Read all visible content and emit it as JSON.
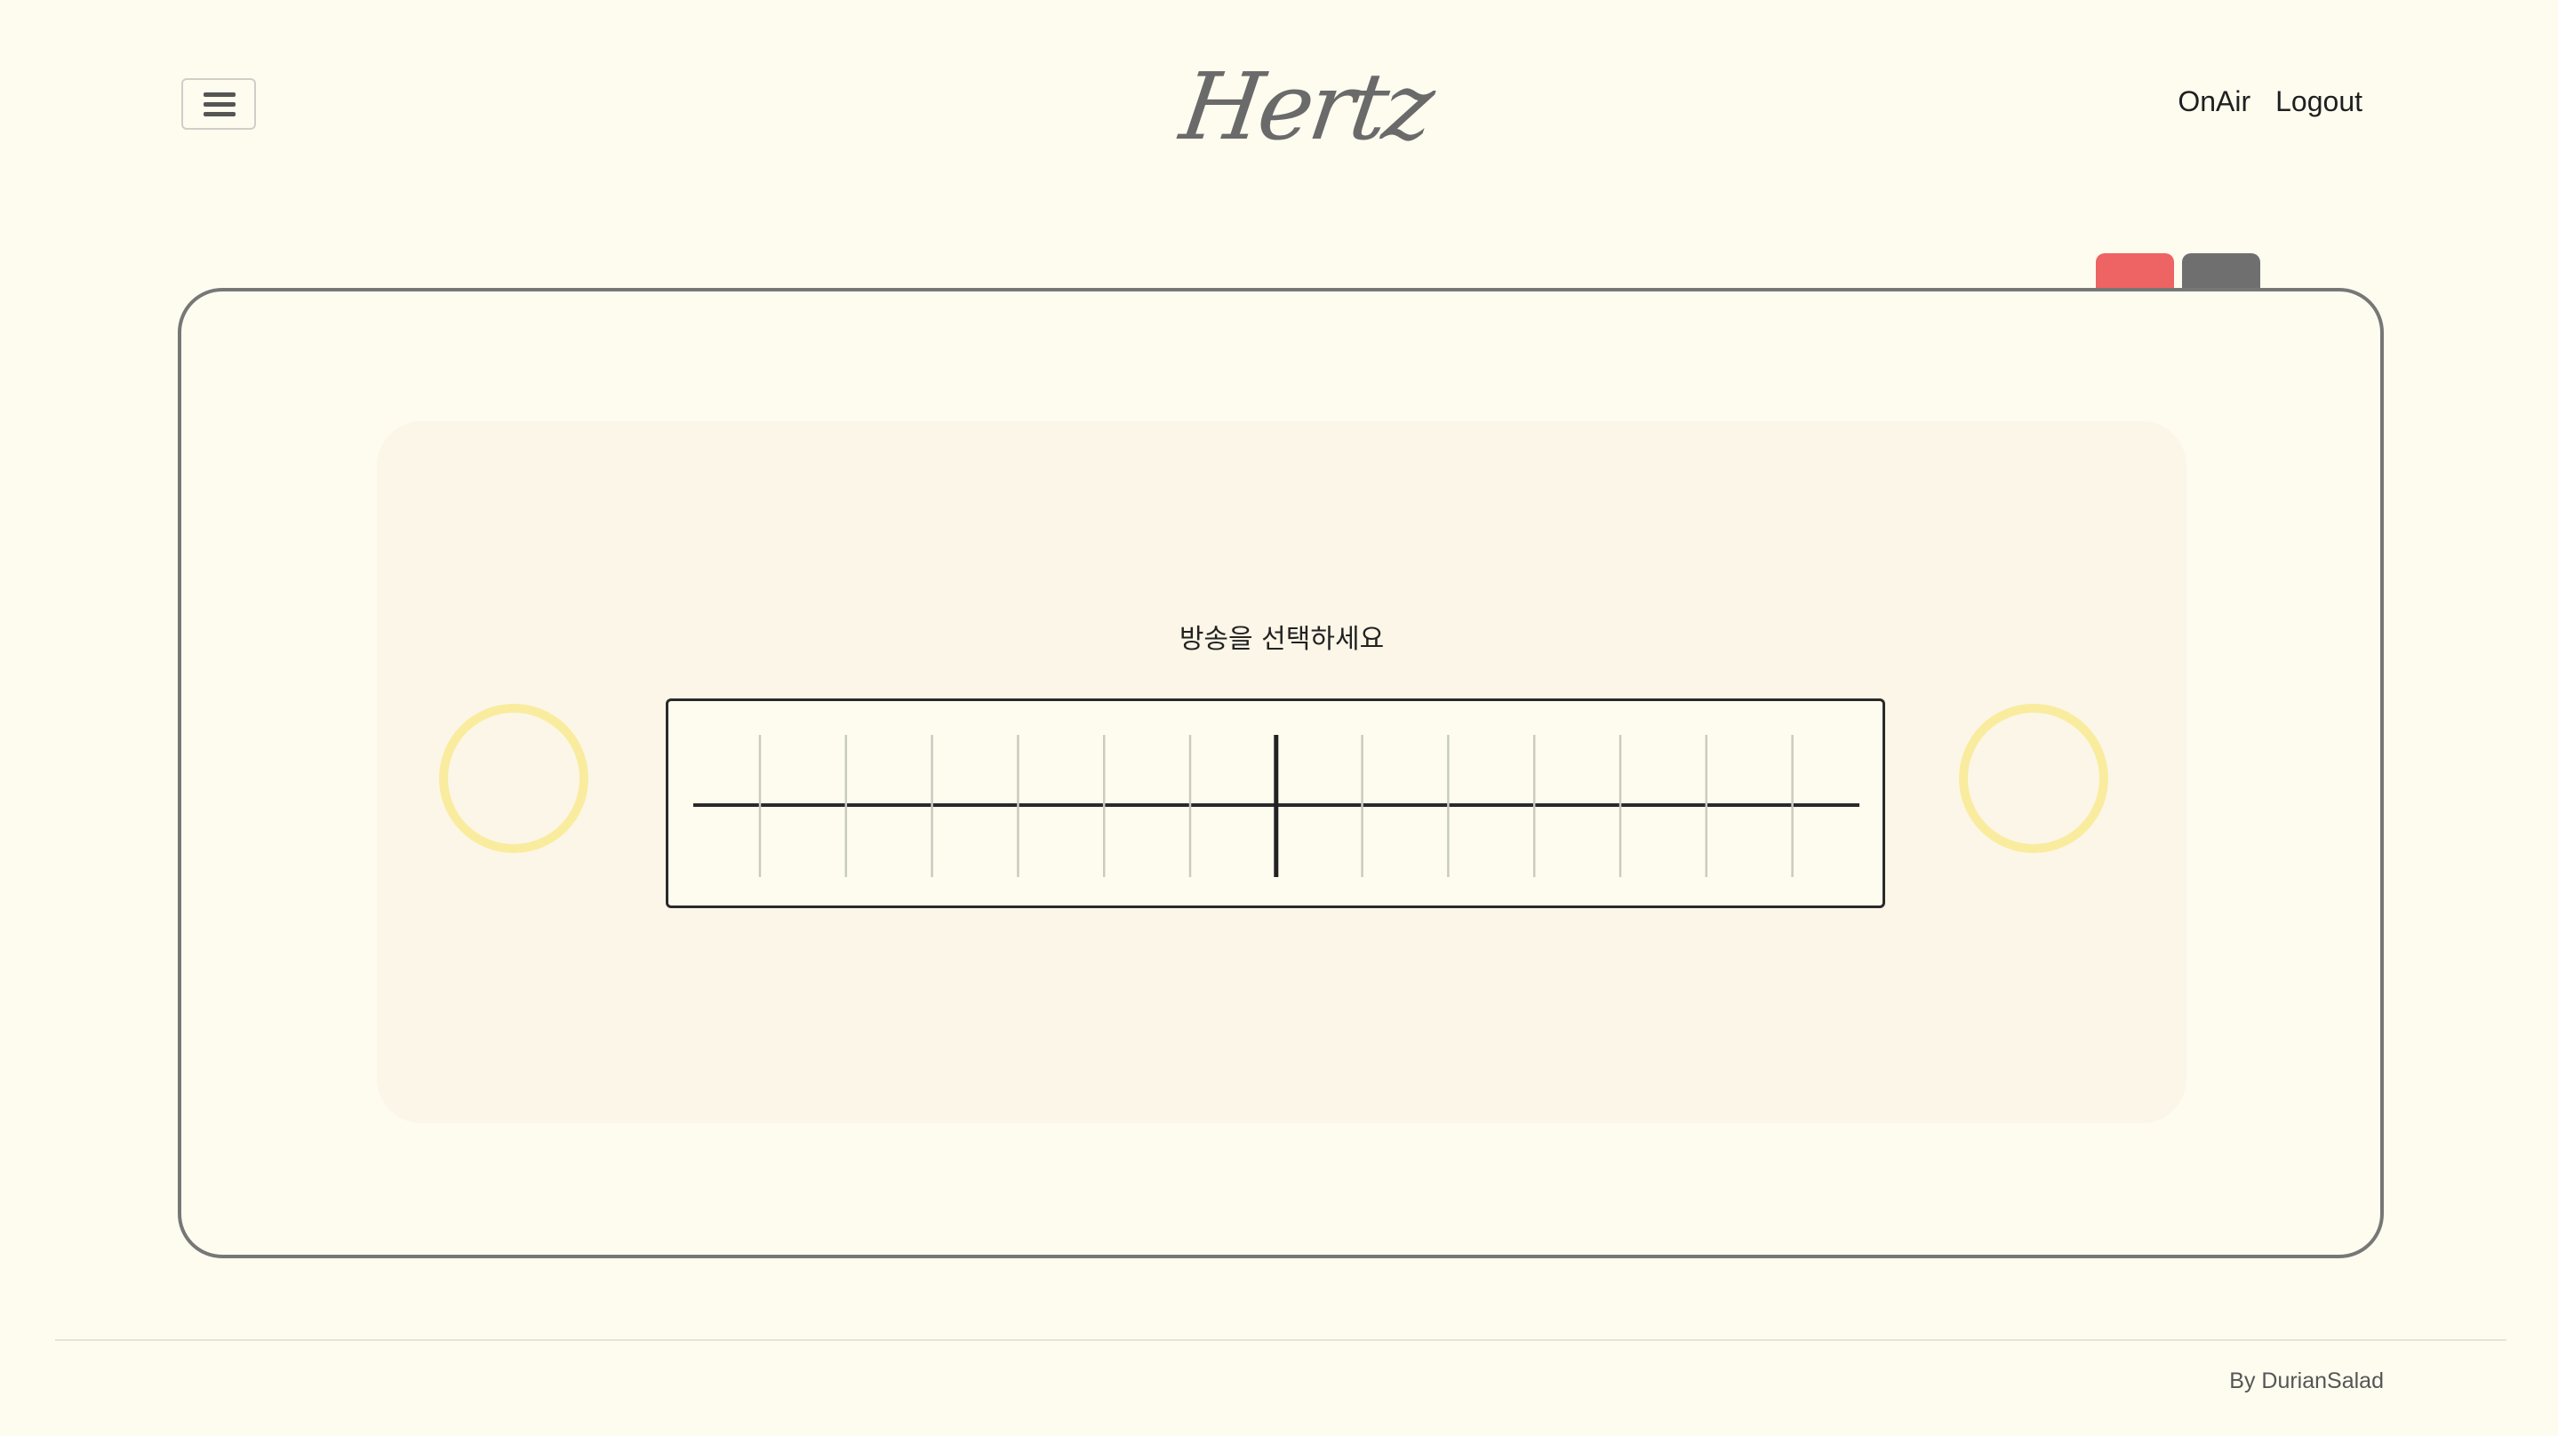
{
  "header": {
    "logo": "Hertz",
    "nav": [
      "OnAir",
      "Logout"
    ]
  },
  "icons": {
    "menu": "hamburger-menu-icon"
  },
  "radio": {
    "prompt": "방송을 선택하세요",
    "dial_ticks": 13,
    "selected_tick": 6
  },
  "colors": {
    "background": "#fefcef",
    "panel": "#fcf6e8",
    "knob": "#f9ec9e",
    "tab_red": "#ee6363",
    "tab_grey": "#6f6f6f",
    "logo": "#6a6a6a"
  },
  "footer": {
    "credit": "By DurianSalad"
  }
}
